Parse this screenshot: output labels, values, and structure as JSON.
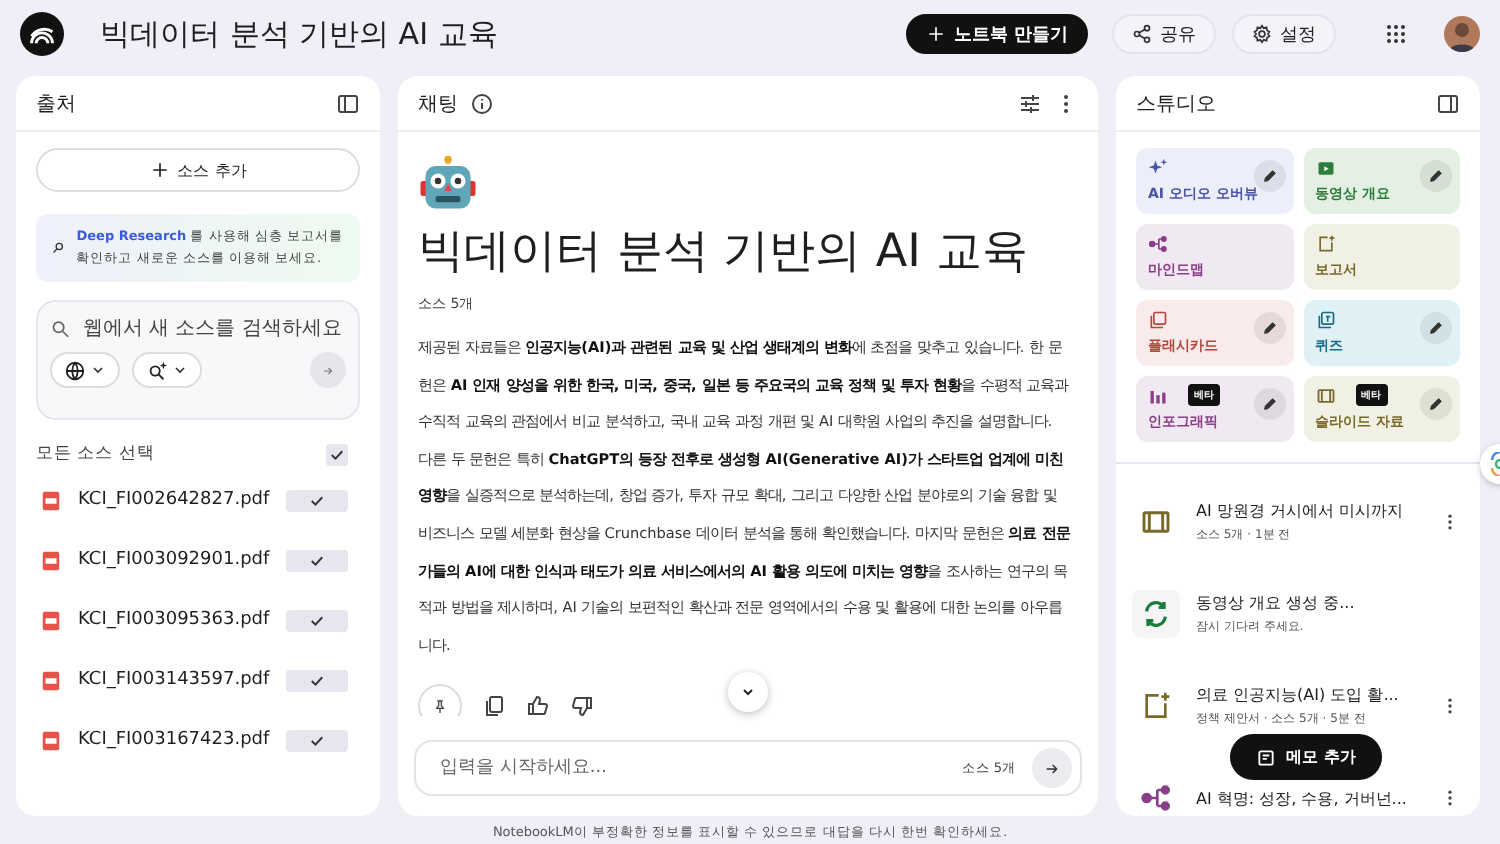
{
  "header": {
    "title": "빅데이터 분석 기반의 AI 교육",
    "create_button": "노트북 만들기",
    "share_button": "공유",
    "settings_button": "설정"
  },
  "sources": {
    "title": "출처",
    "add_button": "소스 추가",
    "notice": {
      "link": "Deep Research",
      "text": "를 사용해 심층 보고서를 확인하고 새로운 소스를 이용해 보세요."
    },
    "search": {
      "placeholder": "웹에서 새 소스를 검색하세요"
    },
    "select_all": {
      "label": "모든 소스 선택",
      "checked": true
    },
    "files": [
      {
        "name": "KCI_FI002642827.pdf",
        "checked": true
      },
      {
        "name": "KCI_FI003092901.pdf",
        "checked": true
      },
      {
        "name": "KCI_FI003095363.pdf",
        "checked": true
      },
      {
        "name": "KCI_FI003143597.pdf",
        "checked": true
      },
      {
        "name": "KCI_FI003167423.pdf",
        "checked": true
      }
    ]
  },
  "chat": {
    "title": "채팅",
    "heading": "빅데이터 분석 기반의 AI 교육",
    "source_count": "소스 5개",
    "summary": "제공된 자료들은 **인공지능(AI)과 관련된 교육 및 산업 생태계의 변화**에 초점을 맞추고 있습니다. 한 문헌은 **AI 인재 양성을 위한 한국, 미국, 중국, 일본 등 주요국의 교육 정책 및 투자 현황**을 수평적 교육과 수직적 교육의 관점에서 비교 분석하고, 국내 교육 과정 개편 및 AI 대학원 사업의 추진을 설명합니다. 다른 두 문헌은 특히 **ChatGPT의 등장 전후로 생성형 AI(Generative AI)가 스타트업 업계에 미친 영향**을 실증적으로 분석하는데, 창업 증가, 투자 규모 확대, 그리고 다양한 산업 분야로의 기술 융합 및 비즈니스 모델 세분화 현상을 Crunchbase 데이터 분석을 통해 확인했습니다. 마지막 문헌은 **의료 전문가들의 AI에 대한 인식과 태도가 의료 서비스에서의 AI 활용 의도에 미치는 영향**을 조사하는 연구의 목적과 방법을 제시하며, AI 기술의 보편적인 확산과 전문 영역에서의 수용 및 활용에 대한 논의를 아우릅니다.",
    "input": {
      "placeholder": "입력을 시작하세요...",
      "source_count": "소스 5개"
    }
  },
  "studio": {
    "title": "스튜디오",
    "tiles": [
      {
        "label": "AI 오디오 오버뷰",
        "kind": "audio",
        "color": "#eceefa",
        "editable": true,
        "beta": false
      },
      {
        "label": "동영상 개요",
        "kind": "video",
        "color": "#e3f0e3",
        "editable": true,
        "beta": false
      },
      {
        "label": "마인드맵",
        "kind": "mindmap",
        "color": "#f1e9f1",
        "editable": false,
        "beta": false
      },
      {
        "label": "보고서",
        "kind": "report",
        "color": "#f1f0e4",
        "editable": false,
        "beta": false
      },
      {
        "label": "플래시카드",
        "kind": "flashcard",
        "color": "#f8ebe9",
        "editable": true,
        "beta": false
      },
      {
        "label": "퀴즈",
        "kind": "quiz",
        "color": "#e0f1f6",
        "editable": true,
        "beta": false
      },
      {
        "label": "인포그래픽",
        "kind": "infographic",
        "color": "#f1e9f1",
        "editable": true,
        "beta": true,
        "beta_label": "베타"
      },
      {
        "label": "슬라이드 자료",
        "kind": "slides",
        "color": "#f1f0e4",
        "editable": true,
        "beta": true,
        "beta_label": "베타"
      }
    ],
    "items": [
      {
        "kind": "slides",
        "title": "AI 망원경 거시에서 미시까지",
        "subtitle": "소스 5개 · 1분 전",
        "menu": true
      },
      {
        "kind": "loading",
        "title": "동영상 개요 생성 중...",
        "subtitle": "잠시 기다려 주세요.",
        "menu": false
      },
      {
        "kind": "report",
        "title": "의료 인공지능(AI) 도입 활...",
        "subtitle": "정책 제안서 · 소스 5개 · 5분 전",
        "menu": true
      },
      {
        "kind": "mindmap",
        "title": "AI 혁명: 성장, 수용, 거버넌...",
        "menu": true
      }
    ],
    "memo_button": "메모 추가"
  },
  "footer": "NotebookLM이 부정확한 정보를 표시할 수 있으므로 대답을 다시 한번 확인하세요."
}
